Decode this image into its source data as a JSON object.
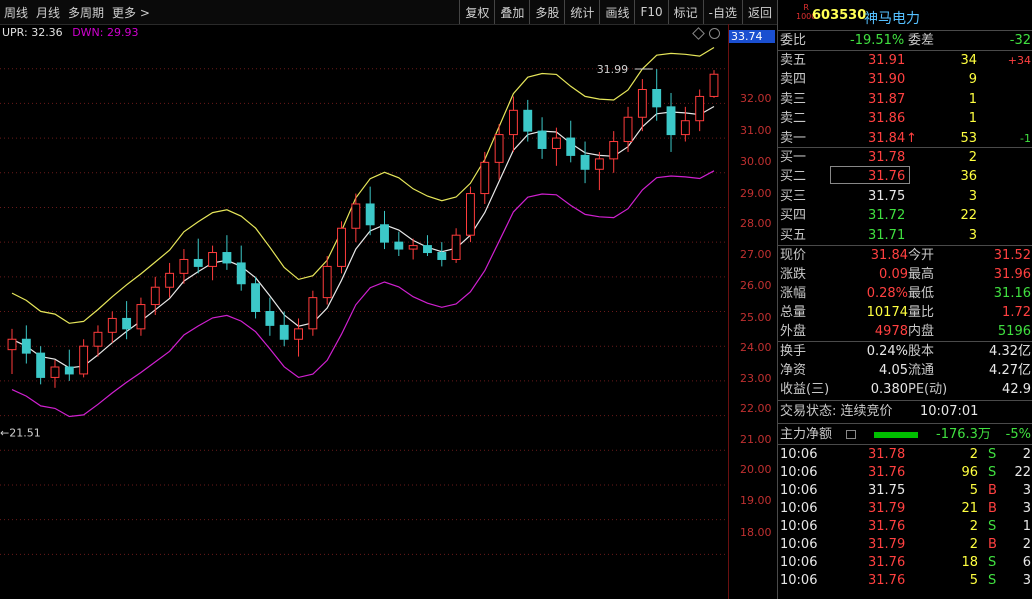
{
  "toolbar": {
    "left": [
      "周线",
      "月线",
      "多周期",
      "更多 >"
    ],
    "right": [
      "复权",
      "叠加",
      "多股",
      "统计",
      "画线",
      "F10",
      "标记",
      "-自选",
      "返回"
    ]
  },
  "indicator": {
    "upr_label": "UPR: 32.36",
    "dwn_label": "DWN: 29.93"
  },
  "price_axis": {
    "current_tag": "33.74",
    "labels": [
      "32.00",
      "31.00",
      "30.00",
      "29.00",
      "28.00",
      "27.00",
      "26.00",
      "25.00",
      "24.00",
      "23.00",
      "22.00",
      "21.00",
      "20.00",
      "19.00",
      "18.00"
    ]
  },
  "annotations": {
    "high_label": "31.99",
    "low_label": "←21.51"
  },
  "chart_data": {
    "type": "candlestick",
    "title": "",
    "ylim": [
      17.0,
      33.0
    ],
    "annotations": [
      {
        "text": "31.99"
      },
      {
        "text": "21.51"
      }
    ],
    "series": [
      {
        "name": "UPR",
        "value": "32.36"
      },
      {
        "name": "DWN",
        "value": "29.93"
      }
    ],
    "candles": [
      [
        23.9,
        24.5,
        23.2,
        24.2
      ],
      [
        24.2,
        24.6,
        23.5,
        23.8
      ],
      [
        23.8,
        24.0,
        22.9,
        23.1
      ],
      [
        23.1,
        23.6,
        22.8,
        23.4
      ],
      [
        23.4,
        23.9,
        23.0,
        23.2
      ],
      [
        23.2,
        24.2,
        23.1,
        24.0
      ],
      [
        24.0,
        24.6,
        23.7,
        24.4
      ],
      [
        24.4,
        25.0,
        24.1,
        24.8
      ],
      [
        24.8,
        25.3,
        24.2,
        24.5
      ],
      [
        24.5,
        25.4,
        24.3,
        25.2
      ],
      [
        25.2,
        26.0,
        24.9,
        25.7
      ],
      [
        25.7,
        26.4,
        25.4,
        26.1
      ],
      [
        26.1,
        26.8,
        25.8,
        26.5
      ],
      [
        26.5,
        27.1,
        26.1,
        26.3
      ],
      [
        26.3,
        26.9,
        25.9,
        26.7
      ],
      [
        26.7,
        27.2,
        26.2,
        26.4
      ],
      [
        26.4,
        26.9,
        25.6,
        25.8
      ],
      [
        25.8,
        26.0,
        24.8,
        25.0
      ],
      [
        25.0,
        25.4,
        24.3,
        24.6
      ],
      [
        24.6,
        25.0,
        24.0,
        24.2
      ],
      [
        24.2,
        24.8,
        23.7,
        24.5
      ],
      [
        24.5,
        25.6,
        24.3,
        25.4
      ],
      [
        25.4,
        26.6,
        25.2,
        26.3
      ],
      [
        26.3,
        27.6,
        26.1,
        27.4
      ],
      [
        27.4,
        28.4,
        27.0,
        28.1
      ],
      [
        28.1,
        28.6,
        27.2,
        27.5
      ],
      [
        27.5,
        27.9,
        26.8,
        27.0
      ],
      [
        27.0,
        27.3,
        26.6,
        26.8
      ],
      [
        26.8,
        27.1,
        26.5,
        26.9
      ],
      [
        26.9,
        27.2,
        26.6,
        26.7
      ],
      [
        26.7,
        27.0,
        26.3,
        26.5
      ],
      [
        26.5,
        27.4,
        26.4,
        27.2
      ],
      [
        27.2,
        28.6,
        27.0,
        28.4
      ],
      [
        28.4,
        29.6,
        28.1,
        29.3
      ],
      [
        29.3,
        30.4,
        28.8,
        30.1
      ],
      [
        30.1,
        31.2,
        29.6,
        30.8
      ],
      [
        30.8,
        31.1,
        29.9,
        30.2
      ],
      [
        30.2,
        30.6,
        29.4,
        29.7
      ],
      [
        29.7,
        30.3,
        29.2,
        30.0
      ],
      [
        30.0,
        30.5,
        29.3,
        29.5
      ],
      [
        29.5,
        29.9,
        28.7,
        29.1
      ],
      [
        29.1,
        29.6,
        28.5,
        29.4
      ],
      [
        29.4,
        30.2,
        29.0,
        29.9
      ],
      [
        29.9,
        30.9,
        29.6,
        30.6
      ],
      [
        30.6,
        31.7,
        30.2,
        31.4
      ],
      [
        31.4,
        31.99,
        30.5,
        30.9
      ],
      [
        30.9,
        31.3,
        29.6,
        30.1
      ],
      [
        30.1,
        30.9,
        29.9,
        30.5
      ],
      [
        30.5,
        31.4,
        30.2,
        31.2
      ],
      [
        31.2,
        31.96,
        31.16,
        31.84
      ]
    ]
  },
  "stock": {
    "r_tag": "R",
    "r_sub": "1000",
    "code": "603530",
    "name": "神马电力"
  },
  "committee": {
    "ratio_label": "委比",
    "ratio_value": "-19.51%",
    "diff_label": "委差",
    "diff_value": "-32"
  },
  "asks": [
    {
      "label": "卖五",
      "price": "31.91",
      "vol": "34",
      "chg": "+34"
    },
    {
      "label": "卖四",
      "price": "31.90",
      "vol": "9",
      "chg": ""
    },
    {
      "label": "卖三",
      "price": "31.87",
      "vol": "1",
      "chg": ""
    },
    {
      "label": "卖二",
      "price": "31.86",
      "vol": "1",
      "chg": ""
    },
    {
      "label": "卖一",
      "price": "31.84",
      "arrow": "↑",
      "vol": "53",
      "chg": "-1"
    }
  ],
  "bids": [
    {
      "label": "买一",
      "price": "31.78",
      "vol": "2"
    },
    {
      "label": "买二",
      "price": "31.76",
      "vol": "36"
    },
    {
      "label": "买三",
      "price": "31.75",
      "vol": "3"
    },
    {
      "label": "买四",
      "price": "31.72",
      "vol": "22"
    },
    {
      "label": "买五",
      "price": "31.71",
      "vol": "3"
    }
  ],
  "quote": [
    {
      "l1": "现价",
      "v1": "31.84",
      "l2": "今开",
      "v2": "31.52"
    },
    {
      "l1": "涨跌",
      "v1": "0.09",
      "l2": "最高",
      "v2": "31.96"
    },
    {
      "l1": "涨幅",
      "v1": "0.28%",
      "l2": "最低",
      "v2": "31.16"
    },
    {
      "l1": "总量",
      "v1": "10174",
      "l2": "量比",
      "v2": "1.72"
    },
    {
      "l1": "外盘",
      "v1": "4978",
      "l2": "内盘",
      "v2": "5196"
    }
  ],
  "finance": [
    {
      "l1": "换手",
      "v1": "0.24%",
      "l2": "股本",
      "v2": "4.32亿"
    },
    {
      "l1": "净资",
      "v1": "4.05",
      "l2": "流通",
      "v2": "4.27亿"
    },
    {
      "l1": "收益(三)",
      "v1": "0.380",
      "l2": "PE(动)",
      "v2": "42.9"
    }
  ],
  "status": {
    "label": "交易状态: 连续竞价",
    "time": "10:07:01"
  },
  "mainforce": {
    "label": "主力净额",
    "value": "-176.3万",
    "pct": "-5%"
  },
  "ticks": [
    {
      "time": "10:06",
      "price": "31.78",
      "vol": "2",
      "side": "S",
      "n": "2"
    },
    {
      "time": "10:06",
      "price": "31.76",
      "vol": "96",
      "side": "S",
      "n": "22"
    },
    {
      "time": "10:06",
      "price": "31.75",
      "vol": "5",
      "side": "B",
      "n": "3"
    },
    {
      "time": "10:06",
      "price": "31.79",
      "vol": "21",
      "side": "B",
      "n": "3"
    },
    {
      "time": "10:06",
      "price": "31.76",
      "vol": "2",
      "side": "S",
      "n": "1"
    },
    {
      "time": "10:06",
      "price": "31.79",
      "vol": "2",
      "side": "B",
      "n": "2"
    },
    {
      "time": "10:06",
      "price": "31.76",
      "vol": "18",
      "side": "S",
      "n": "6"
    },
    {
      "time": "10:06",
      "price": "31.76",
      "vol": "5",
      "side": "S",
      "n": "3"
    }
  ]
}
